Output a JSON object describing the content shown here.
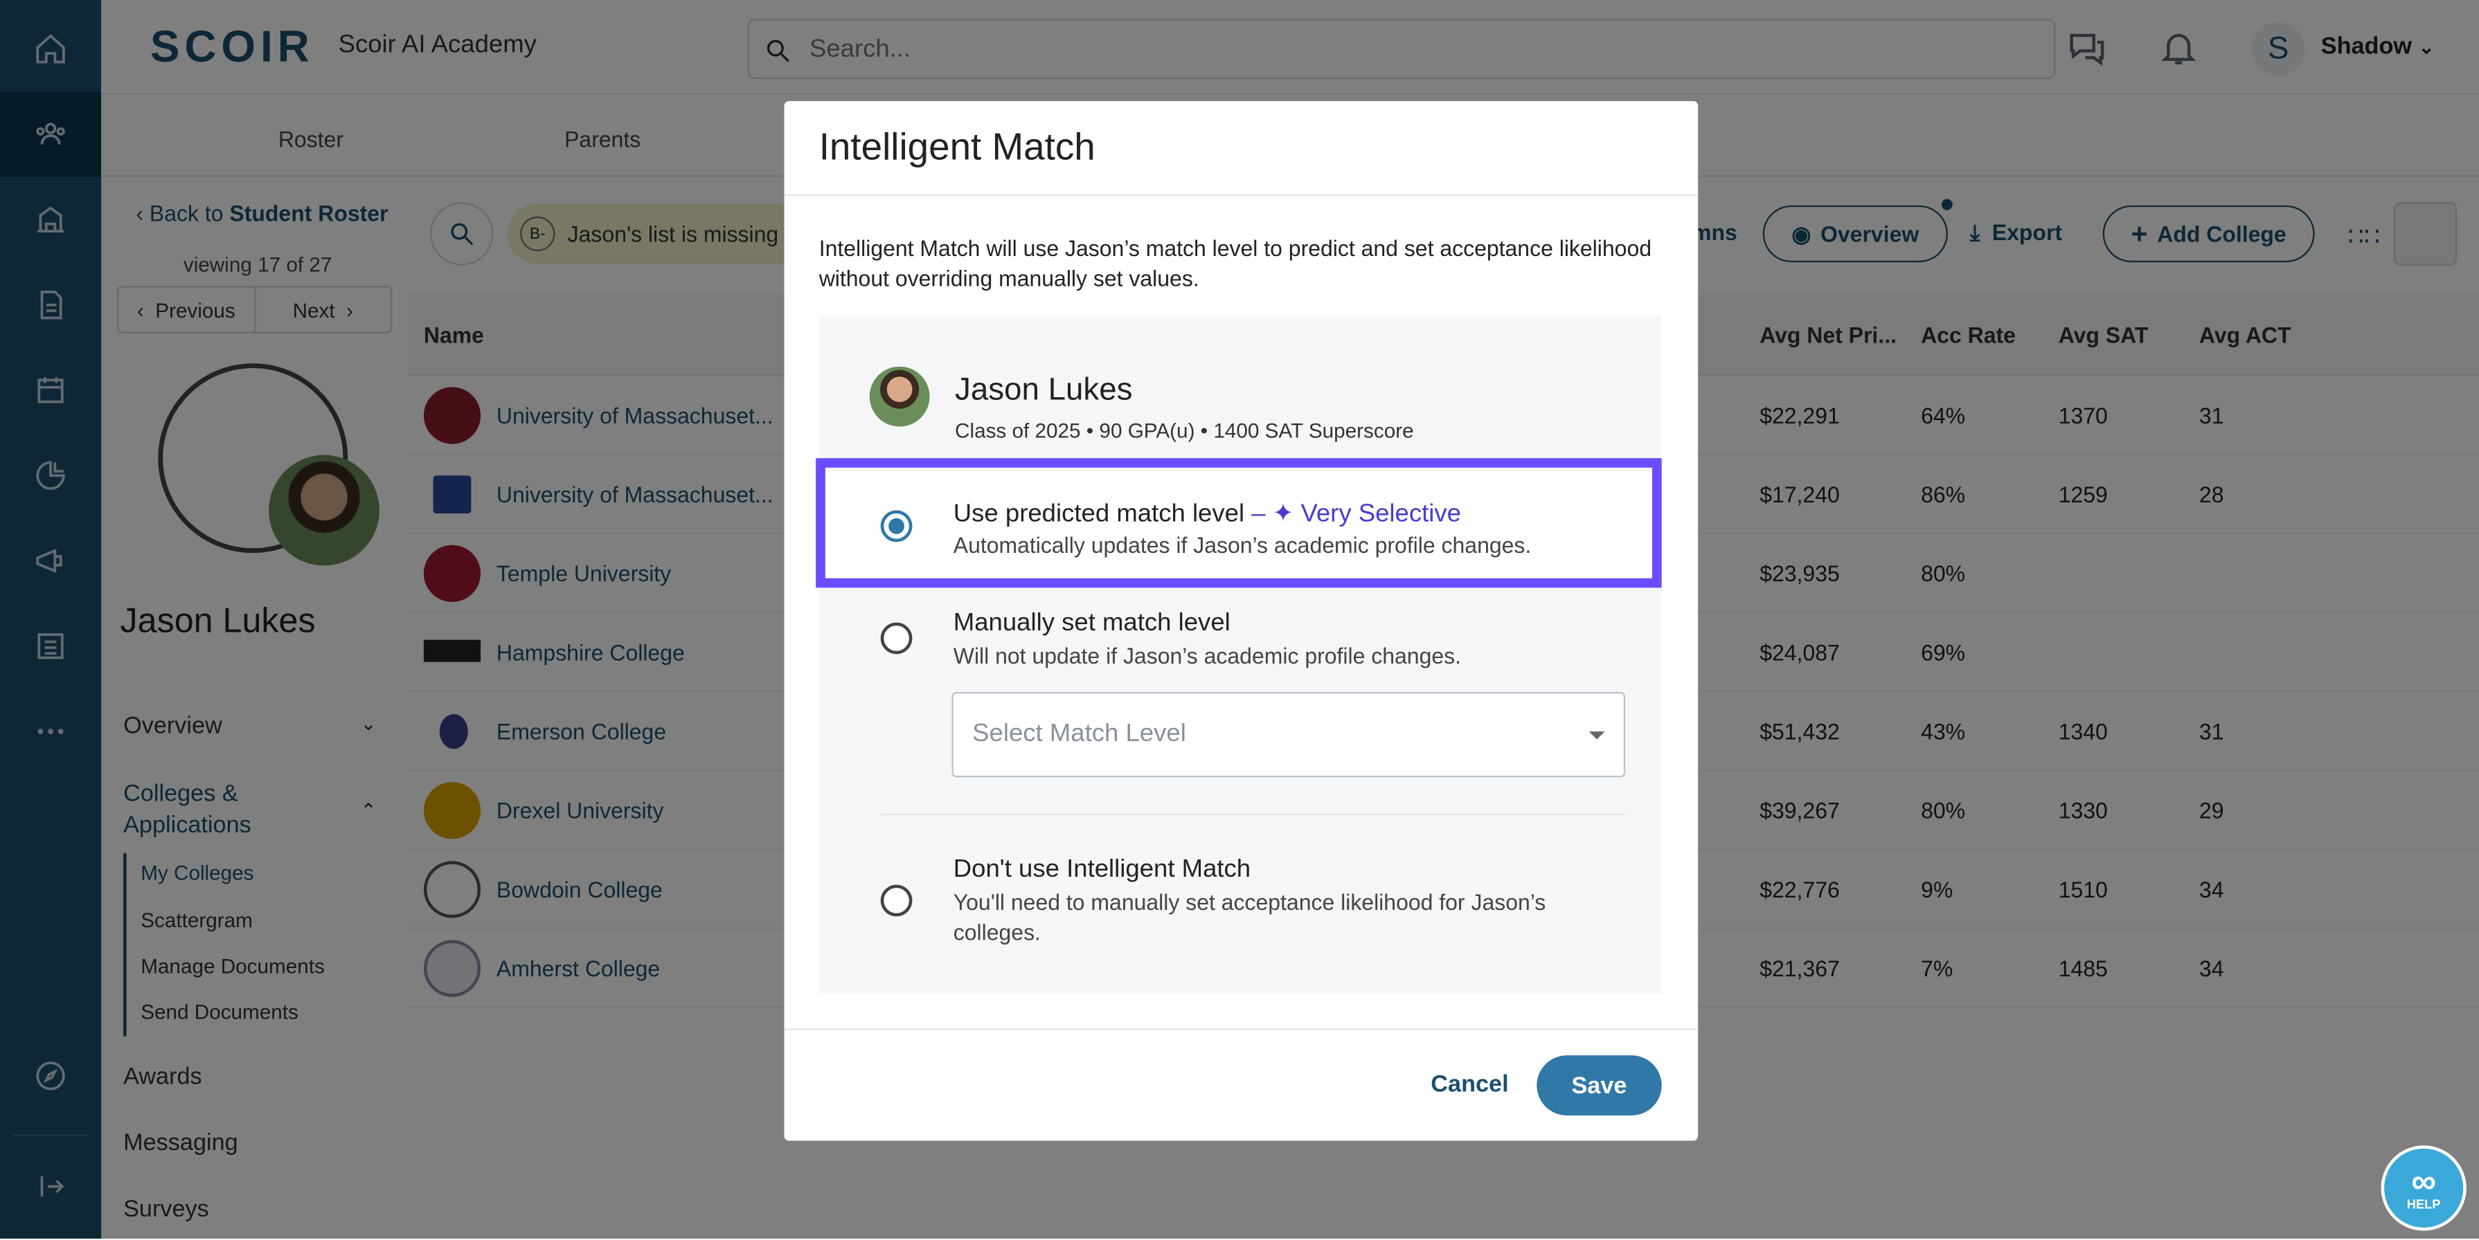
{
  "topbar": {
    "logo_text": "SCOIR",
    "brand": "Scoir AI Academy",
    "search_placeholder": "Search...",
    "user_initial": "S",
    "user_name": "Shadow"
  },
  "subnav": {
    "tabs": [
      "Roster",
      "Parents"
    ]
  },
  "sidebar": {
    "back_prefix": "Back to",
    "back_link": "Student Roster",
    "viewing": "viewing 17 of 27",
    "previous": "Previous",
    "next": "Next",
    "student_name": "Jason Lukes",
    "nav": [
      "Overview",
      "Colleges & Applications",
      "Awards",
      "Messaging",
      "Surveys"
    ],
    "sub_nav": [
      "My Colleges",
      "Scattergram",
      "Manage Documents",
      "Send Documents"
    ]
  },
  "toolbar": {
    "chip_badge": "B-",
    "chip_text": "Jason's list is missing",
    "columns_partial": "mns",
    "overview": "Overview",
    "export": "Export",
    "add_college": "Add College"
  },
  "table": {
    "headers": {
      "name": "Name",
      "net_price": "Avg Net Pri...",
      "acc_rate": "Acc Rate",
      "sat": "Avg SAT",
      "act": "Avg ACT"
    },
    "rows": [
      {
        "name": "University of Massachuset...",
        "net_price": "$22,291",
        "acc_rate": "64%",
        "sat": "1370",
        "act": "31"
      },
      {
        "name": "University of Massachuset...",
        "net_price": "$17,240",
        "acc_rate": "86%",
        "sat": "1259",
        "act": "28"
      },
      {
        "name": "Temple University",
        "net_price": "$23,935",
        "acc_rate": "80%",
        "sat": "",
        "act": ""
      },
      {
        "name": "Hampshire College",
        "net_price": "$24,087",
        "acc_rate": "69%",
        "sat": "",
        "act": ""
      },
      {
        "name": "Emerson College",
        "net_price": "$51,432",
        "acc_rate": "43%",
        "sat": "1340",
        "act": "31"
      },
      {
        "name": "Drexel University",
        "net_price": "$39,267",
        "acc_rate": "80%",
        "sat": "1330",
        "act": "29"
      },
      {
        "name": "Bowdoin College",
        "net_price": "$22,776",
        "acc_rate": "9%",
        "sat": "1510",
        "act": "34"
      },
      {
        "name": "Amherst College",
        "net_price": "$21,367",
        "acc_rate": "7%",
        "sat": "1485",
        "act": "34"
      }
    ]
  },
  "modal": {
    "title": "Intelligent Match",
    "description": "Intelligent Match will use Jason’s match level to predict and set acceptance likelihood without overriding manually set values.",
    "student_name": "Jason Lukes",
    "student_meta": "Class of 2025 • 90 GPA(u) • 1400 SAT Superscore",
    "option1_title": "Use predicted match level",
    "option1_dash": " – ",
    "option1_level": "Very Selective",
    "option1_sub": "Automatically updates if Jason’s academic profile changes.",
    "option2_title": "Manually set match level",
    "option2_sub": "Will not update if Jason’s academic profile changes.",
    "select_placeholder": "Select Match Level",
    "option3_title": "Don't use Intelligent Match",
    "option3_sub": "You'll need to manually set acceptance likelihood for Jason’s colleges.",
    "cancel": "Cancel",
    "save": "Save"
  },
  "help": {
    "label": "HELP"
  },
  "colors": {
    "brand": "#1d4f6f",
    "accent": "#2f78a8",
    "highlight": "#6b4dff",
    "match_level": "#4a3ad1"
  }
}
